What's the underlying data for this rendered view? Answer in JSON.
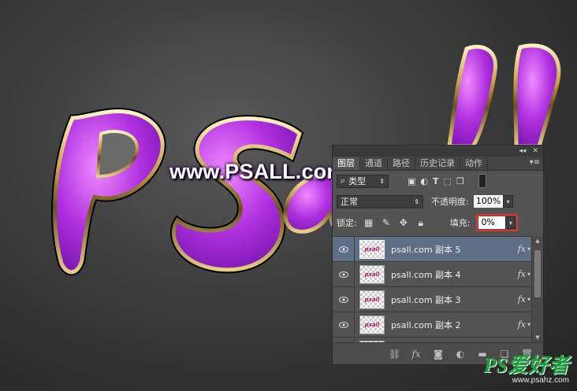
{
  "canvas": {
    "artwork_text": "psall",
    "watermark": "www.PSALL.com"
  },
  "panel": {
    "topbar": {
      "collapse": "◂◂",
      "close": "✕"
    },
    "tabs": [
      {
        "label": "图层",
        "active": true
      },
      {
        "label": "通道",
        "active": false
      },
      {
        "label": "路径",
        "active": false
      },
      {
        "label": "历史记录",
        "active": false
      },
      {
        "label": "动作",
        "active": false
      }
    ],
    "menu_icon": "▾≡",
    "filter": {
      "kind": "类型",
      "icons": [
        "pixel-filter-icon",
        "adjustment-filter-icon",
        "type-filter-icon",
        "shape-filter-icon",
        "smart-object-filter-icon"
      ]
    },
    "blend_mode": "正常",
    "opacity_label": "不透明度:",
    "opacity_value": "100%",
    "lock_label": "锁定:",
    "fill_label": "填充:",
    "fill_value": "0%",
    "layers": [
      {
        "name": "psall.com 副本 5",
        "selected": true,
        "fx": "fx"
      },
      {
        "name": "psall.com 副本 4",
        "selected": false,
        "fx": "fx"
      },
      {
        "name": "psall.com 副本 3",
        "selected": false,
        "fx": "fx"
      },
      {
        "name": "psall.com 副本 2",
        "selected": false,
        "fx": "fx"
      }
    ],
    "footer_icons": [
      "link-icon",
      "fx-icon",
      "mask-icon",
      "adjustment-icon",
      "folder-icon",
      "new-layer-icon",
      "trash-icon"
    ]
  },
  "brand": {
    "main": "PS爱好者",
    "sub": "www.psahz.com"
  },
  "colors": {
    "fill_highlight": "#e8302a",
    "selected_layer": "#5f6e84",
    "letter_fill": "#b030e0",
    "gold_outline": "#d4b060"
  }
}
